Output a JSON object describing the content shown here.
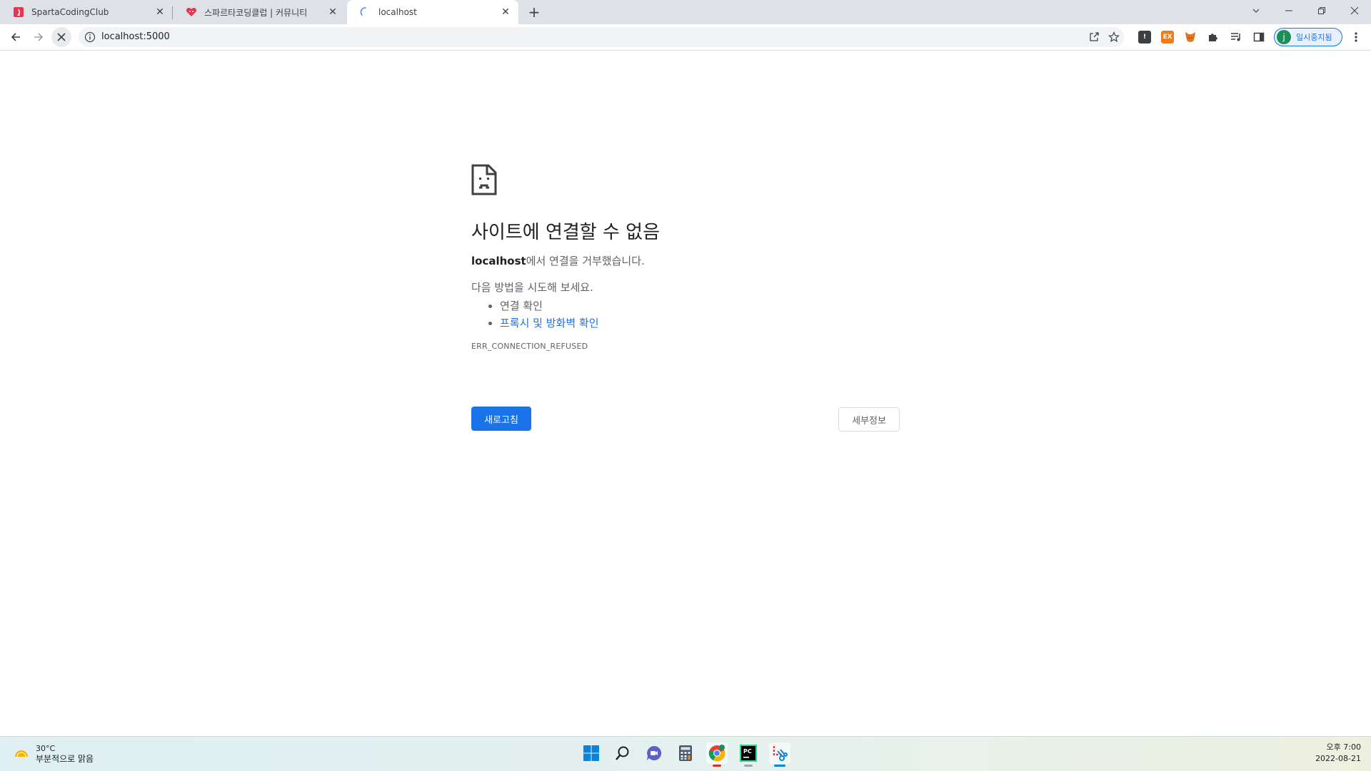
{
  "browser": {
    "tabs": [
      {
        "title": "SpartaCodingClub",
        "favicon": "sparta-favicon",
        "active": false
      },
      {
        "title": "스파르타코딩클럽 | 커뮤니티",
        "favicon": "heart-favicon",
        "active": false
      },
      {
        "title": "localhost",
        "favicon": "loading-spinner",
        "active": true
      }
    ],
    "new_tab_label": "+",
    "url": "localhost:5000",
    "profile_initial": "j",
    "profile_label": "일시중지됨",
    "extensions": [
      "extension-dark-icon",
      "extension-ex-icon",
      "metamask-fox-icon",
      "puzzle-extensions-icon",
      "reading-list-icon",
      "side-panel-icon"
    ],
    "ext_ex_label": "EX",
    "ext_dark_label": "!"
  },
  "error_page": {
    "heading": "사이트에 연결할 수 없음",
    "host": "localhost",
    "summary_suffix": "에서 연결을 거부했습니다.",
    "suggestions_intro": "다음 방법을 시도해 보세요.",
    "suggestions": [
      {
        "text": "연결 확인",
        "link": false
      },
      {
        "text": "프록시 및 방화벽 확인",
        "link": true
      }
    ],
    "error_code": "ERR_CONNECTION_REFUSED",
    "reload_button": "새로고침",
    "details_button": "세부정보"
  },
  "taskbar": {
    "weather_temp": "30°C",
    "weather_condition": "부분적으로 맑음",
    "apps": [
      "windows-start-icon",
      "search-icon",
      "chat-icon",
      "calculator-icon",
      "chrome-icon",
      "pycharm-icon",
      "snipping-tool-icon"
    ],
    "clock_time": "오후 7:00",
    "clock_date": "2022-08-21"
  },
  "colors": {
    "accent": "#1a73e8",
    "tabstrip": "#dee1e6",
    "text_secondary": "#5f6368"
  }
}
